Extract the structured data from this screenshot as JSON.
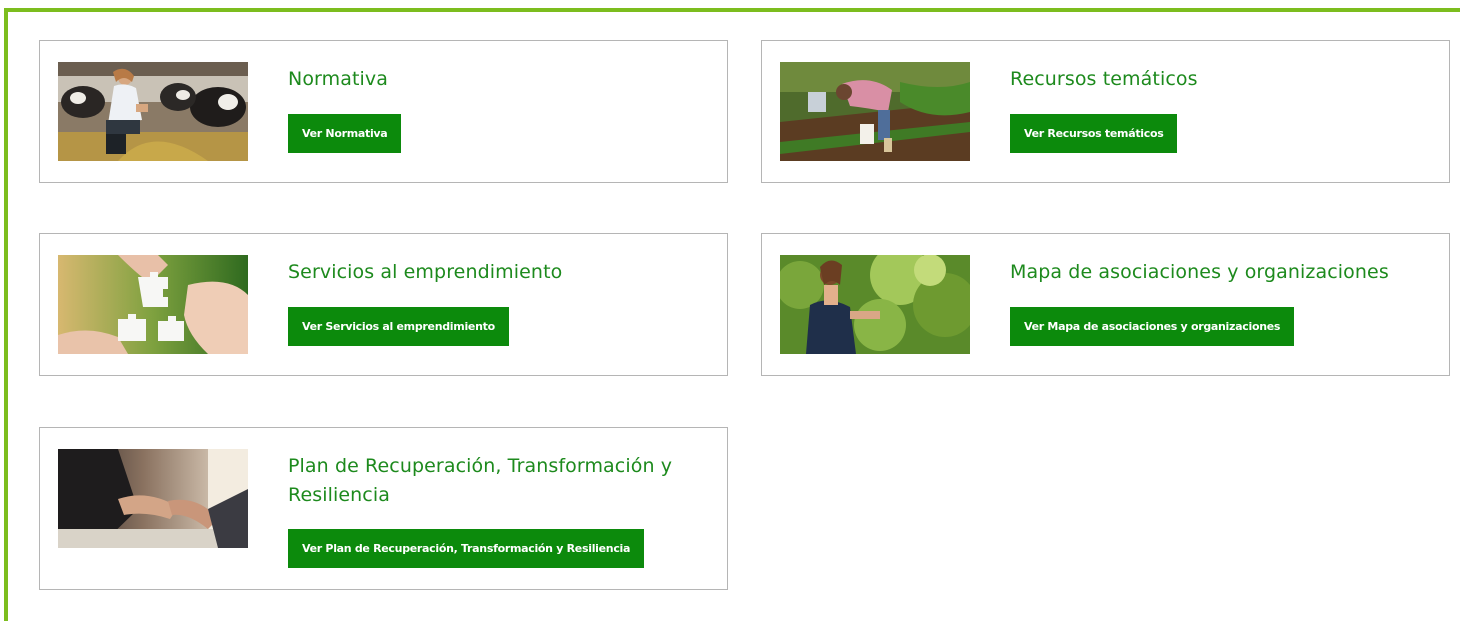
{
  "colors": {
    "frame_border": "#7cbd1e",
    "title_green": "#1d8a1d",
    "button_green": "#0c8a0c",
    "card_border": "#b5b5b5"
  },
  "cards": [
    {
      "title": "Normativa",
      "button": "Ver Normativa",
      "image": "farmer-with-cows-photo"
    },
    {
      "title": "Recursos temáticos",
      "button": "Ver Recursos temáticos",
      "image": "woman-planting-field-photo"
    },
    {
      "title": "Servicios al emprendimiento",
      "button": "Ver Servicios al emprendimiento",
      "image": "hands-puzzle-pieces-photo"
    },
    {
      "title": "Mapa de asociaciones y organizaciones",
      "button": "Ver Mapa de asociaciones y organizaciones",
      "image": "woman-in-vineyard-photo"
    },
    {
      "title": "Plan de Recuperación, Transformación y Resiliencia",
      "button": "Ver Plan de Recuperación, Transformación y Resiliencia",
      "image": "business-handshake-photo"
    }
  ]
}
